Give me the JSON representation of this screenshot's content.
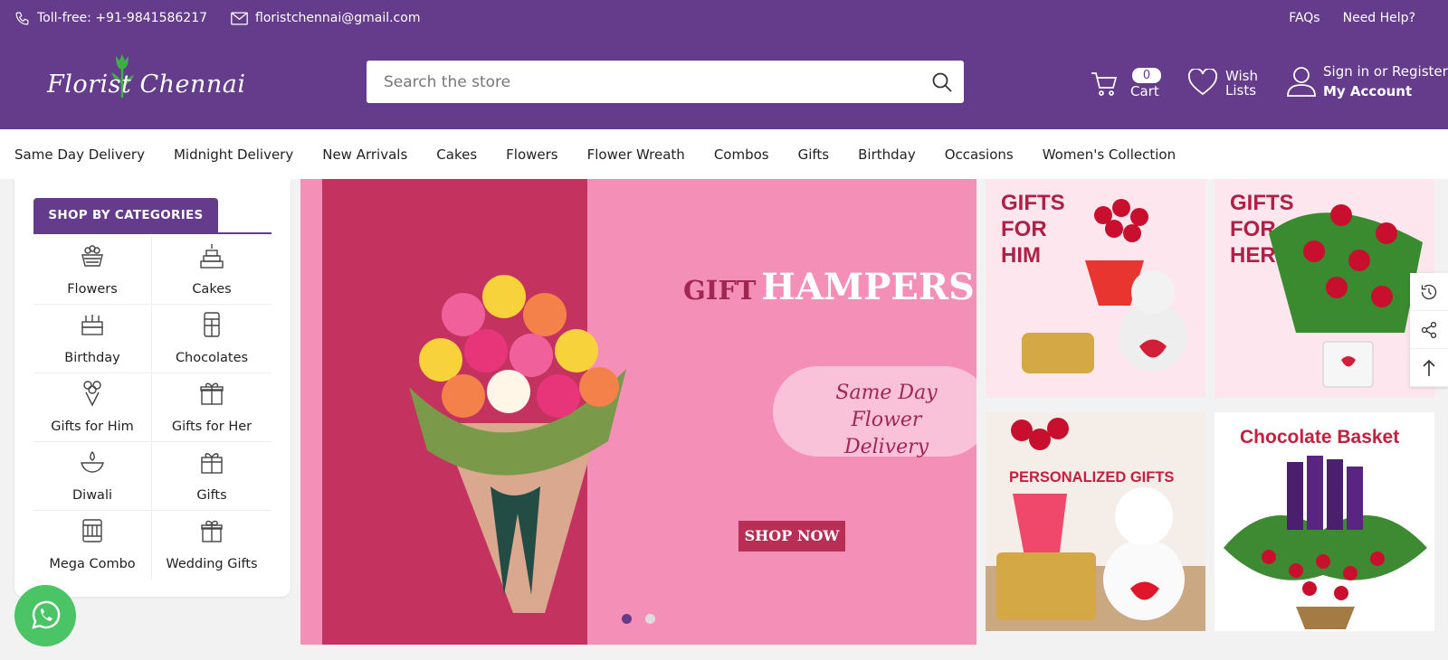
{
  "topbar": {
    "phone_text": "Toll-free: +91-9841586217",
    "email_text": "floristchennai@gmail.com",
    "faqs": "FAQs",
    "help": "Need Help?"
  },
  "header": {
    "logo_text": "Florist Chennai",
    "search_placeholder": "Search the store",
    "cart_count": "0",
    "cart_label": "Cart",
    "wish_label_1": "Wish",
    "wish_label_2": "Lists",
    "sign_in": "Sign in or Register",
    "my_account": "My Account"
  },
  "nav": [
    "Same Day Delivery",
    "Midnight Delivery",
    "New Arrivals",
    "Cakes",
    "Flowers",
    "Flower Wreath",
    "Combos",
    "Gifts",
    "Birthday",
    "Occasions",
    "Women's Collection"
  ],
  "categories": {
    "title": "SHOP BY CATEGORIES",
    "items": [
      {
        "label": "Flowers",
        "icon": "flower-basket-icon"
      },
      {
        "label": "Cakes",
        "icon": "cake-icon"
      },
      {
        "label": "Birthday",
        "icon": "birthday-cake-icon"
      },
      {
        "label": "Chocolates",
        "icon": "chocolate-icon"
      },
      {
        "label": "Gifts for Him",
        "icon": "bouquet-icon"
      },
      {
        "label": "Gifts for Her",
        "icon": "gift-box-icon"
      },
      {
        "label": "Diwali",
        "icon": "diya-icon"
      },
      {
        "label": "Gifts",
        "icon": "gifts-icon"
      },
      {
        "label": "Mega Combo",
        "icon": "combo-box-icon"
      },
      {
        "label": "Wedding Gifts",
        "icon": "wedding-gift-icon"
      }
    ]
  },
  "hero": {
    "title_small": "GIFT",
    "title_big": "HAMPERS",
    "pill_line1": "Same Day",
    "pill_line2": "Flower Delivery",
    "shop_now": "SHOP NOW",
    "slides": 2,
    "active_slide": 1
  },
  "tiles": {
    "t1": [
      "GIFTS",
      "FOR",
      "HIM"
    ],
    "t2": [
      "GIFTS",
      "FOR",
      "HER"
    ],
    "t3": "PERSONALIZED GIFTS",
    "t4": "Chocolate Basket"
  },
  "colors": {
    "brand": "#653b8c",
    "accent": "#b01f46",
    "whatsapp": "#4bc466"
  }
}
